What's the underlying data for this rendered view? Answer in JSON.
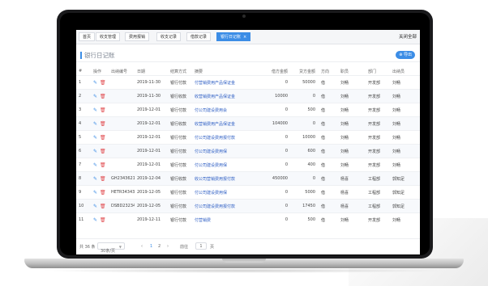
{
  "tabs": [
    {
      "label": "首页"
    },
    {
      "label": "收支管理"
    },
    {
      "label": "费用报销"
    },
    {
      "label": "收支记录"
    },
    {
      "label": "借款记录"
    },
    {
      "label": "银行日记账",
      "active": true
    }
  ],
  "close_all_label": "关闭全部",
  "page_title": "银行日记账",
  "export_label": "导出",
  "columns": [
    "#",
    "操作",
    "出纳编号",
    "日期",
    "结算方式",
    "摘要",
    "借方金额",
    "贷方金额",
    "方向",
    "职员",
    "部门",
    "出纳员"
  ],
  "rows": [
    {
      "no": "1",
      "code": "",
      "date": "2019-11-30",
      "method": "银行付款",
      "summary": "付营销费用产品保证金",
      "debit": "0",
      "credit": "50000",
      "dir": "借",
      "staff": "刘畅",
      "dept": "开发部",
      "cashier": "刘畅"
    },
    {
      "no": "2",
      "code": "",
      "date": "2019-11-30",
      "method": "银行收款",
      "summary": "收营销费用产品保证金",
      "debit": "10000",
      "credit": "0",
      "dir": "借",
      "staff": "刘畅",
      "dept": "开发部",
      "cashier": "刘畅"
    },
    {
      "no": "3",
      "code": "",
      "date": "2019-12-01",
      "method": "银行付款",
      "summary": "付公司建设费用会",
      "debit": "0",
      "credit": "500",
      "dir": "借",
      "staff": "刘畅",
      "dept": "开发部",
      "cashier": "刘畅"
    },
    {
      "no": "4",
      "code": "",
      "date": "2019-12-01",
      "method": "银行收款",
      "summary": "收营销费用产品保证金",
      "debit": "104000",
      "credit": "0",
      "dir": "借",
      "staff": "刘畅",
      "dept": "开发部",
      "cashier": "刘畅"
    },
    {
      "no": "5",
      "code": "",
      "date": "2019-12-01",
      "method": "银行付款",
      "summary": "付公司建设费用报付款",
      "debit": "0",
      "credit": "10000",
      "dir": "借",
      "staff": "刘畅",
      "dept": "开发部",
      "cashier": "刘畅"
    },
    {
      "no": "6",
      "code": "",
      "date": "2019-12-01",
      "method": "银行付款",
      "summary": "付公司建设费用保",
      "debit": "0",
      "credit": "600",
      "dir": "借",
      "staff": "刘畅",
      "dept": "开发部",
      "cashier": "刘畅"
    },
    {
      "no": "7",
      "code": "",
      "date": "2019-12-01",
      "method": "银行付款",
      "summary": "付公司建设费用保",
      "debit": "0",
      "credit": "400",
      "dir": "借",
      "staff": "刘畅",
      "dept": "开发部",
      "cashier": "刘畅"
    },
    {
      "no": "8",
      "code": "GH2343621",
      "date": "2019-12-04",
      "method": "银行收款",
      "summary": "收公司营销费用报付款",
      "debit": "450000",
      "credit": "0",
      "dir": "借",
      "staff": "杨喜",
      "dept": "工程部",
      "cashier": "郭知足"
    },
    {
      "no": "9",
      "code": "HETR34343",
      "date": "2019-12-05",
      "method": "银行付款",
      "summary": "付公司建设费用保",
      "debit": "0",
      "credit": "5000",
      "dir": "借",
      "staff": "杨喜",
      "dept": "工程部",
      "cashier": "郭知足"
    },
    {
      "no": "10",
      "code": "DSBD23234",
      "date": "2019-12-05",
      "method": "银行付款",
      "summary": "付公司建设费用报付款",
      "debit": "0",
      "credit": "17450",
      "dir": "借",
      "staff": "杨喜",
      "dept": "工程部",
      "cashier": "郭知足"
    },
    {
      "no": "11",
      "code": "",
      "date": "2019-12-11",
      "method": "银行付款",
      "summary": "付营销费",
      "debit": "0",
      "credit": "500",
      "dir": "借",
      "staff": "刘畅",
      "dept": "开发部",
      "cashier": "刘畅"
    }
  ],
  "footer": {
    "total": "共 36 条",
    "page_size": "30条/页",
    "prev": "‹",
    "pages": [
      "1",
      "2"
    ],
    "next": "›",
    "goto_label": "前往",
    "goto_value": "1",
    "page_unit": "页"
  },
  "colors": {
    "accent": "#3c8de6",
    "danger": "#e0484c",
    "link": "#2f5fc4"
  },
  "icons": {
    "edit": "edit-icon",
    "delete": "trash-icon",
    "export": "plus-icon"
  }
}
